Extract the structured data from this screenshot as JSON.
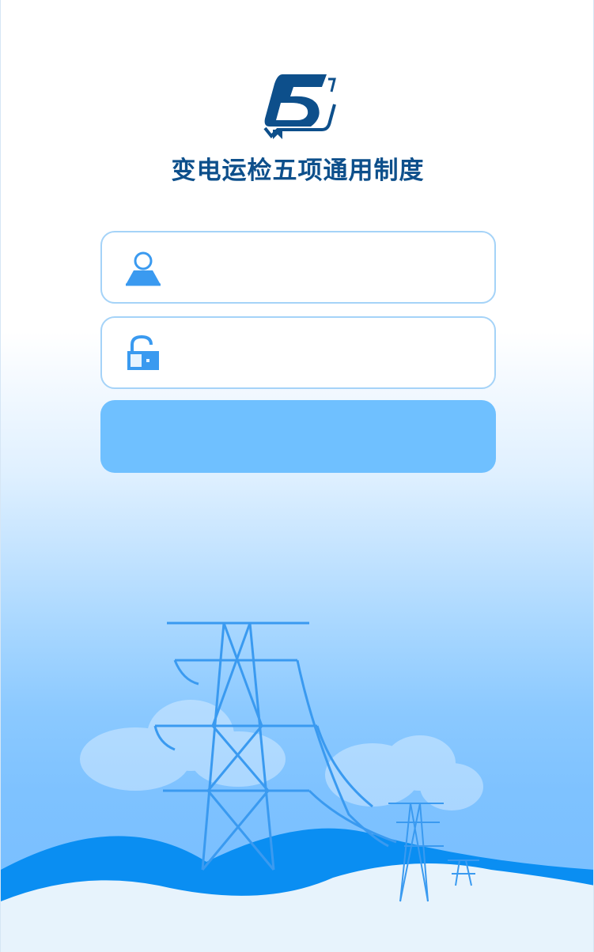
{
  "app": {
    "title": "变电运检五项通用制度",
    "logo_icon": "book-five-logo-icon",
    "brand_color": "#0d4f8b",
    "accent_color": "#6fc0ff"
  },
  "login": {
    "username": {
      "icon": "user-icon",
      "value": "",
      "placeholder": ""
    },
    "password": {
      "icon": "unlock-icon",
      "value": "",
      "placeholder": ""
    },
    "login_button_label": ""
  },
  "illustration": {
    "icon": "power-transmission-tower-illustration"
  }
}
